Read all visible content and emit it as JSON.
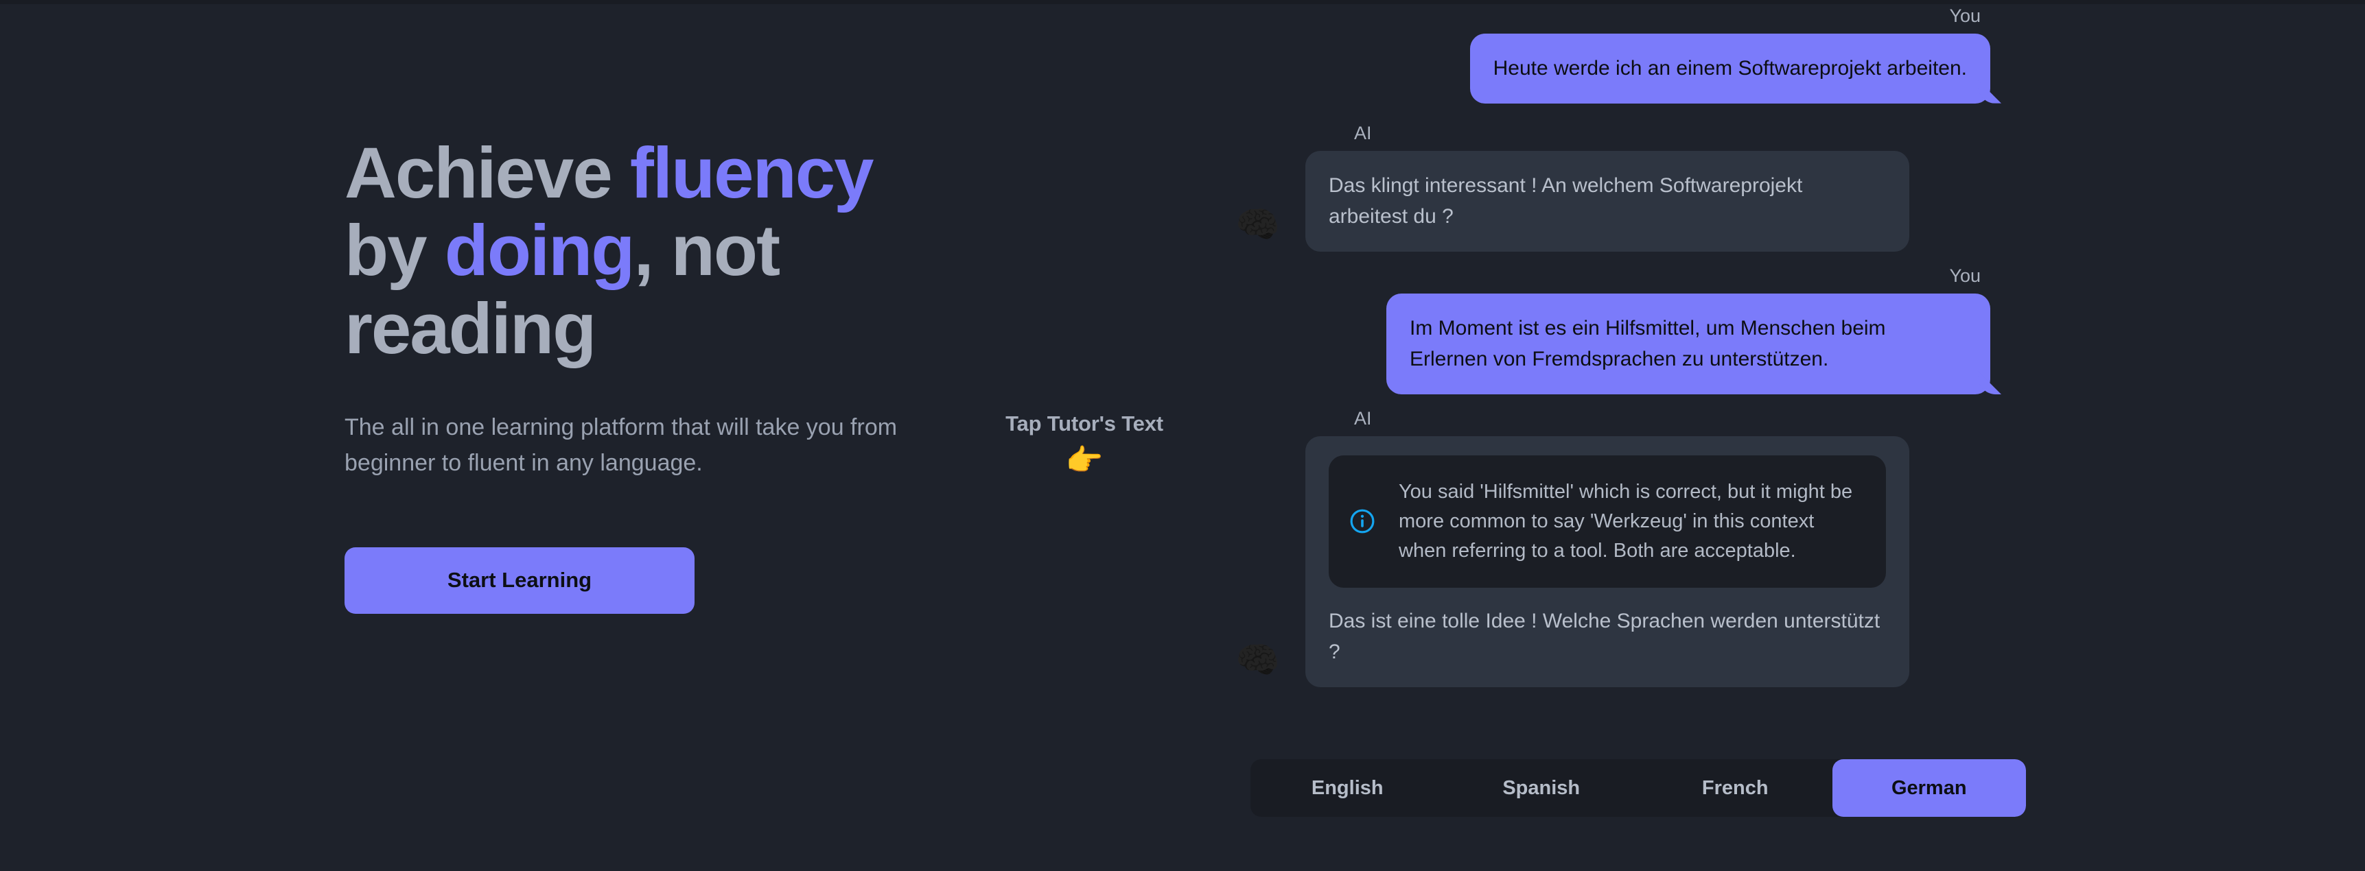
{
  "hero": {
    "title_part1": "Achieve ",
    "title_accent1": "fluency",
    "title_part2": "by ",
    "title_accent2": "doing",
    "title_part3": ", not",
    "title_part4": "reading",
    "subtitle": "The all in one learning platform that will take you from beginner to fluent in any language.",
    "cta_label": "Start Learning"
  },
  "hint": {
    "label": "Tap Tutor's Text",
    "emoji": "👉"
  },
  "chat": {
    "user_label": "You",
    "ai_label": "AI",
    "avatar_glyph": "🧠",
    "messages": [
      {
        "role": "You",
        "text": "Heute werde ich an einem Softwareprojekt arbeiten."
      },
      {
        "role": "AI",
        "text": "Das klingt interessant ! An welchem Softwareprojekt arbeitest du ?"
      },
      {
        "role": "You",
        "text": "Im Moment ist es ein Hilfsmittel, um Menschen beim Erlernen von Fremdsprachen zu unterstützen."
      },
      {
        "role": "AI",
        "correction": "You said 'Hilfsmittel' which is correct, but it might be more common to say 'Werkzeug' in this context when referring to a tool. Both are acceptable.",
        "text": "Das ist eine tolle Idee ! Welche Sprachen werden unterstützt ?"
      }
    ]
  },
  "languages": {
    "options": [
      "English",
      "Spanish",
      "French",
      "German"
    ],
    "selected": "German"
  },
  "colors": {
    "background": "#1e222b",
    "accent": "#7b7bfa",
    "ai_bubble": "#2e3541",
    "correction_card": "#1b1e25",
    "info_icon": "#14a5f0",
    "heading": "#a7aebc",
    "body_text": "#9aa2b1"
  }
}
